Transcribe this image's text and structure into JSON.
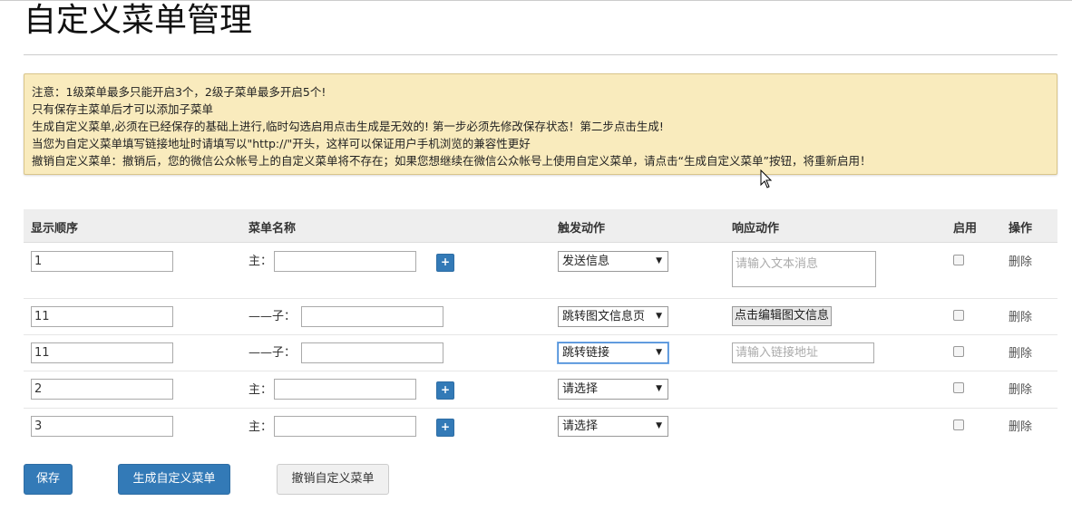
{
  "page": {
    "title": "自定义菜单管理"
  },
  "notice": {
    "lines": [
      "注意：1级菜单最多只能开启3个，2级子菜单最多开启5个!",
      "只有保存主菜单后才可以添加子菜单",
      "生成自定义菜单,必须在已经保存的基础上进行,临时勾选启用点击生成是无效的! 第一步必须先修改保存状态！第二步点击生成!",
      "当您为自定义菜单填写链接地址时请填写以\"http://\"开头，这样可以保证用户手机浏览的兼容性更好",
      "撤销自定义菜单：撤销后，您的微信公众帐号上的自定义菜单将不存在；如果您想继续在微信公众帐号上使用自定义菜单，请点击“生成自定义菜单”按钮，将重新启用！"
    ]
  },
  "table": {
    "headers": {
      "order": "显示顺序",
      "name": "菜单名称",
      "trigger": "触发动作",
      "response": "响应动作",
      "enabled": "启用",
      "ops": "操作"
    },
    "rows": [
      {
        "order": "1",
        "prefix": "主：",
        "name": "",
        "trigger": "发送信息",
        "response_placeholder": "请输入文本消息",
        "delete": "删除"
      },
      {
        "order": "11",
        "prefix": "——子：",
        "name": "",
        "trigger": "跳转图文信息页",
        "response_button": "点击编辑图文信息",
        "delete": "删除"
      },
      {
        "order": "11",
        "prefix": "——子：",
        "name": "",
        "trigger": "跳转链接",
        "response_placeholder": "请输入链接地址",
        "delete": "删除"
      },
      {
        "order": "2",
        "prefix": "主：",
        "name": "",
        "trigger": "请选择",
        "delete": "删除"
      },
      {
        "order": "3",
        "prefix": "主：",
        "name": "",
        "trigger": "请选择",
        "delete": "删除"
      }
    ],
    "plus_label": "+"
  },
  "actions": {
    "save": "保存",
    "generate": "生成自定义菜单",
    "revoke": "撤销自定义菜单"
  },
  "colors": {
    "primary": "#337ab7",
    "notice_bg": "#f9ebbd",
    "header_bg": "#eeeeee"
  }
}
